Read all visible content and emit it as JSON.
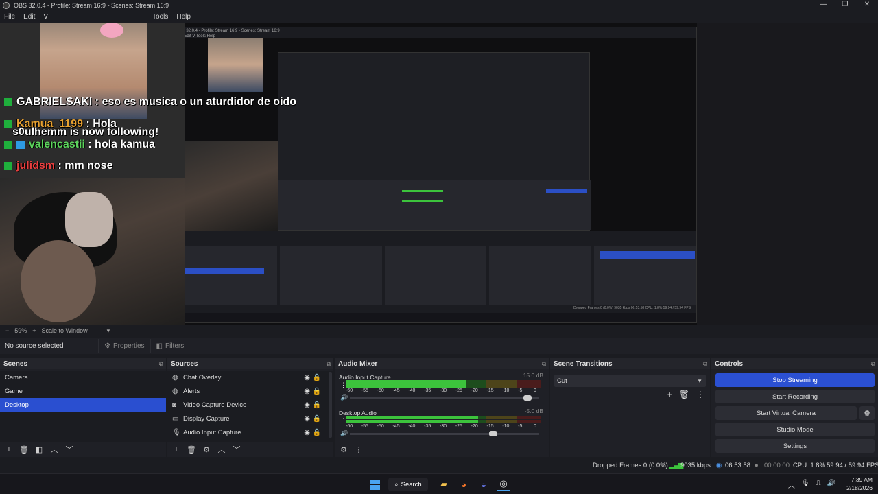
{
  "window": {
    "title": "OBS 32.0.4 - Profile: Stream 16:9 - Scenes: Stream 16:9",
    "minimize": "—",
    "maximize": "❐",
    "close": "✕"
  },
  "menu": {
    "items": [
      "File",
      "Edit",
      "V",
      "Tools",
      "Help"
    ]
  },
  "preview": {
    "chat": [
      {
        "user": "GABRIELSAKI",
        "msg": " : eso es musica o un aturdidor de oido"
      },
      {
        "user": "Kamua_1199",
        "msg": " : Hola",
        "overlay": "s0ulhemm is now following!"
      },
      {
        "user": "valencastii",
        "msg": " : hola kamua"
      },
      {
        "user": "julidsm",
        "msg": " : mm nose"
      }
    ],
    "nested": {
      "title": "OBS 32.0.4 - Profile: Stream 16:9 - Scenes: Stream 16:9",
      "menu": "File  Edit  V  Tools  Help",
      "status": "Dropped Frames 0 (0.0%)   9035 kbps   06:53:58   CPU: 1.8%   59.94 / 59.94 FPS"
    }
  },
  "zoom": {
    "minus": "−",
    "level": "59%",
    "plus": "+",
    "mode": "Scale to Window",
    "caret": "▾"
  },
  "toolbar": {
    "no_source": "No source selected",
    "properties": "Properties",
    "filters": "Filters"
  },
  "scenes": {
    "title": "Scenes",
    "items": [
      "Camera",
      "Game",
      "Desktop"
    ],
    "selected": "Desktop"
  },
  "sources": {
    "title": "Sources",
    "items": [
      "Chat Overlay",
      "Alerts",
      "Video Capture Device",
      "Display Capture",
      "Audio Input Capture"
    ]
  },
  "mixer": {
    "title": "Audio Mixer",
    "channels": [
      {
        "name": "Audio Input Capture",
        "db": "15.0 dB",
        "level": 0.62,
        "volume": 0.96
      },
      {
        "name": "Desktop Audio",
        "db": "-5.0 dB",
        "level": 0.68,
        "volume": 0.77
      }
    ],
    "ticks": [
      "-60",
      "-55",
      "-50",
      "-45",
      "-40",
      "-35",
      "-30",
      "-25",
      "-20",
      "-15",
      "-10",
      "-5",
      "0"
    ]
  },
  "transitions": {
    "title": "Scene Transitions",
    "selected": "Cut"
  },
  "controls": {
    "title": "Controls",
    "stop_streaming": "Stop Streaming",
    "start_recording": "Start Recording",
    "start_virtual_camera": "Start Virtual Camera",
    "studio_mode": "Studio Mode",
    "settings": "Settings"
  },
  "status": {
    "dropped": "Dropped Frames 0 (0.0%)",
    "bitrate": "9035 kbps",
    "stream_time": "06:53:58",
    "rec_time": "00:00:00",
    "cpu": "CPU: 1.8%",
    "fps": "59.94 / 59.94 FPS"
  },
  "taskbar": {
    "search": "Search",
    "time": "7:39 AM",
    "date": "2/18/2026"
  },
  "colors": {
    "accent": "#2b50d2",
    "meter_green": "#3cc33c",
    "meter_yellow": "#c9a92a",
    "meter_red": "#c93232"
  }
}
